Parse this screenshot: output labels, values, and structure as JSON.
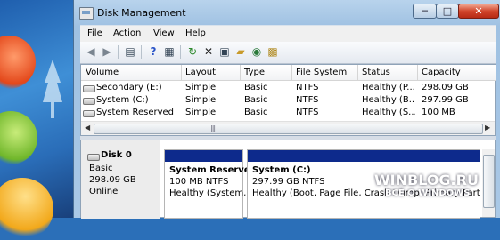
{
  "window": {
    "title": "Disk Management"
  },
  "titlebar_buttons": {
    "minimize": "─",
    "maximize": "□",
    "close": "✕"
  },
  "menu": [
    "File",
    "Action",
    "View",
    "Help"
  ],
  "toolbar": {
    "icons": [
      "back-icon",
      "forward-icon",
      "list-view-icon",
      "help-icon",
      "properties-icon",
      "refresh-icon",
      "delete-icon",
      "settings-icon",
      "open-folder-icon",
      "search-icon",
      "disk-properties-icon"
    ]
  },
  "volume_table": {
    "columns": [
      "Volume",
      "Layout",
      "Type",
      "File System",
      "Status",
      "Capacity"
    ],
    "rows": [
      [
        "Secondary (E:)",
        "Simple",
        "Basic",
        "NTFS",
        "Healthy (P...",
        "298.09 GB"
      ],
      [
        "System (C:)",
        "Simple",
        "Basic",
        "NTFS",
        "Healthy (B...",
        "297.99 GB"
      ],
      [
        "System Reserved",
        "Simple",
        "Basic",
        "NTFS",
        "Healthy (S...",
        "100 MB"
      ]
    ]
  },
  "disk": {
    "name": "Disk 0",
    "type": "Basic",
    "size": "298.09 GB",
    "status": "Online"
  },
  "partitions": [
    {
      "name": "System Reserve",
      "size": "100 MB NTFS",
      "status": "Healthy (System,"
    },
    {
      "name": "System  (C:)",
      "size": "297.99 GB NTFS",
      "status": "Healthy (Boot, Page File, Crash Dump, Primary Partitio"
    }
  ],
  "watermark": {
    "line1": "WINBLOG.RU",
    "line2": "ВСЁ О WINDOWS"
  },
  "colors": {
    "partition_bar": "#0d2a8c",
    "title_close": "#c8391f"
  }
}
